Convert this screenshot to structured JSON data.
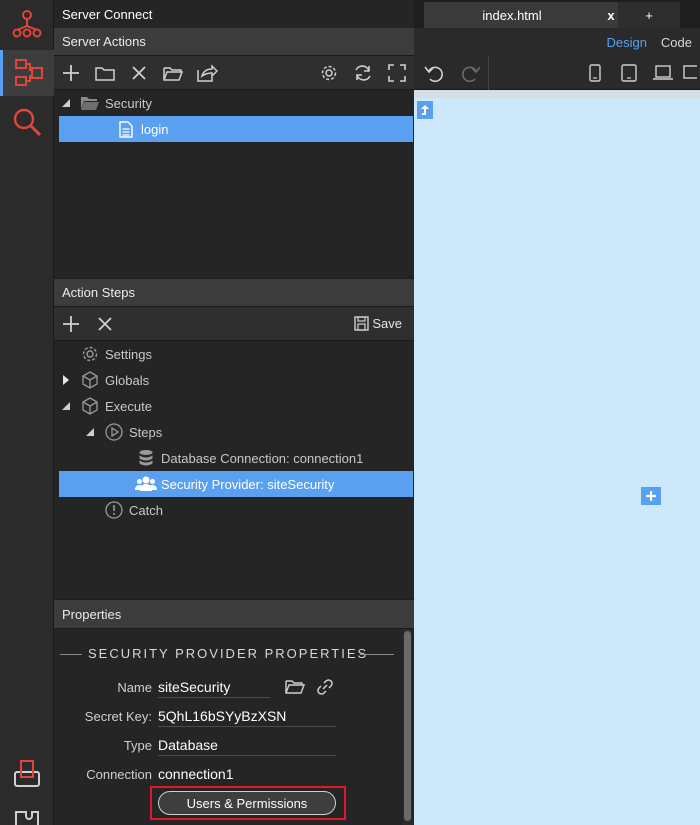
{
  "window": {
    "title": "Server Connect"
  },
  "rail": {
    "items": [
      {
        "icon": "app-structure-icon"
      },
      {
        "icon": "server-connect-icon"
      },
      {
        "icon": "search-icon"
      },
      {
        "icon": "printer-icon"
      },
      {
        "icon": "extensions-icon"
      }
    ]
  },
  "server_actions": {
    "header": "Server Actions",
    "toolbar": [
      "add-icon",
      "folder-icon",
      "delete-icon",
      "open-folder-icon",
      "share-icon",
      "gear-icon",
      "refresh-icon",
      "fullscreen-icon"
    ],
    "tree": [
      {
        "label": "Security",
        "icon": "folder-open-icon",
        "expanded": true
      },
      {
        "label": "login",
        "icon": "file-icon",
        "selected": true
      }
    ]
  },
  "action_steps": {
    "header": "Action Steps",
    "save_label": "Save",
    "tree": [
      {
        "label": "Settings",
        "icon": "gear-icon"
      },
      {
        "label": "Globals",
        "icon": "cube-icon",
        "collapsed": true
      },
      {
        "label": "Execute",
        "icon": "cube-icon",
        "expanded": true
      },
      {
        "label": "Steps",
        "icon": "play-circle-icon",
        "expanded": true
      },
      {
        "label": "Database Connection: connection1",
        "icon": "database-icon"
      },
      {
        "label": "Security Provider: siteSecurity",
        "icon": "users-icon",
        "selected": true
      },
      {
        "label": "Catch",
        "icon": "exclamation-circle-icon"
      }
    ]
  },
  "properties": {
    "header": "Properties",
    "section_title": "SECURITY PROVIDER PROPERTIES",
    "fields": {
      "name": {
        "label": "Name",
        "value": "siteSecurity"
      },
      "secret_key": {
        "label": "Secret Key:",
        "value": "5QhL16bSYyBzXSN"
      },
      "type": {
        "label": "Type",
        "value": "Database"
      },
      "connection": {
        "label": "Connection",
        "value": "connection1"
      }
    },
    "users_permissions_button": "Users & Permissions"
  },
  "editor": {
    "tabs": [
      {
        "label": "index.html",
        "close": "x",
        "active": true
      },
      {
        "label": "+"
      }
    ],
    "view_modes": {
      "design": "Design",
      "code": "Code"
    },
    "colors": {
      "canvas": "#cce8fa",
      "accent": "#5aa0f0",
      "highlight": "#e0192a"
    }
  }
}
